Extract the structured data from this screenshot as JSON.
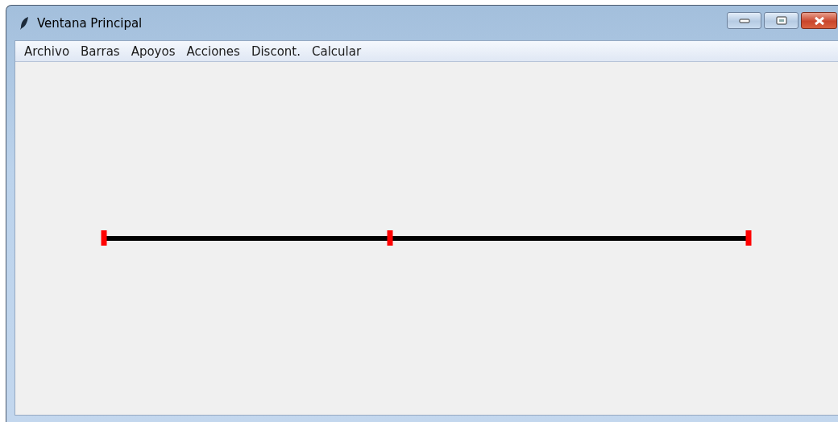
{
  "window": {
    "title": "Ventana Principal"
  },
  "menu": [
    "Archivo",
    "Barras",
    "Apoyos",
    "Acciones",
    "Discont.",
    "Calcular"
  ]
}
